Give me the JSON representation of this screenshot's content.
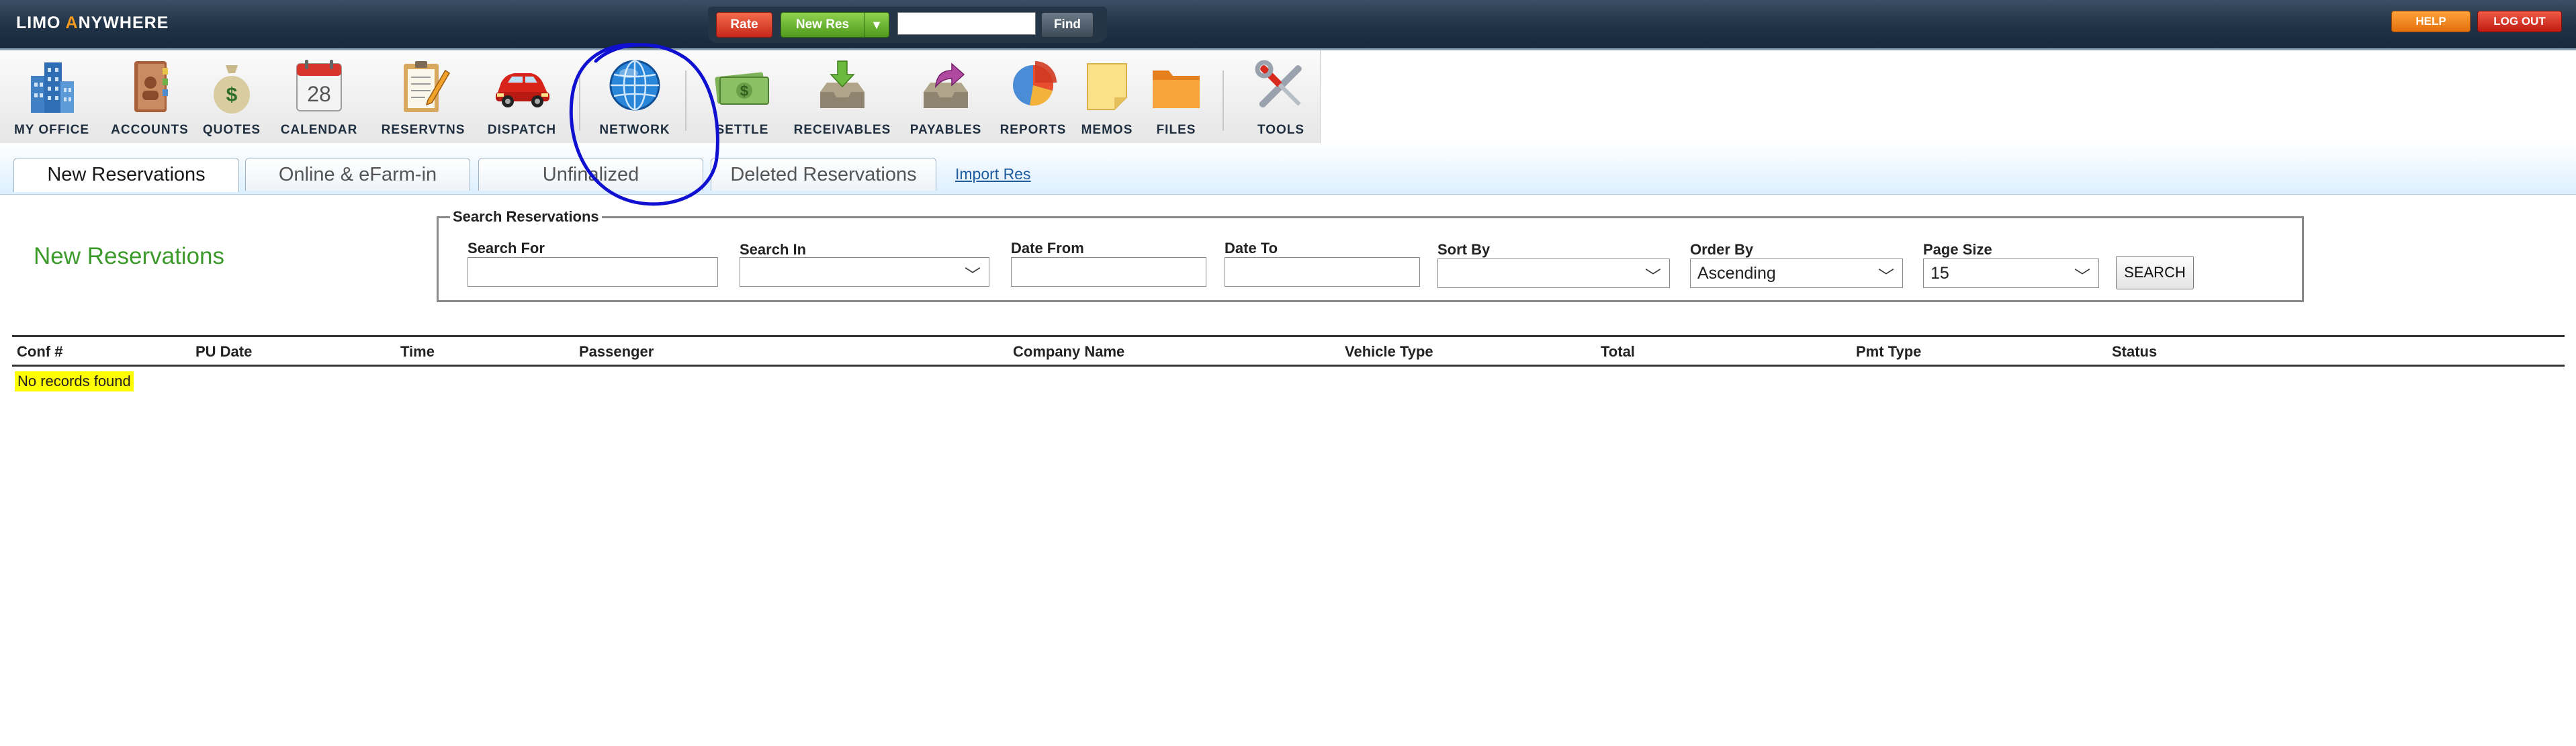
{
  "header": {
    "logo_text_1": "LIMO ",
    "logo_text_a": "A",
    "logo_text_2": "NYWHERE",
    "rate_label": "Rate",
    "new_res_label": "New Res",
    "find_placeholder": "",
    "find_label": "Find",
    "help_label": "HELP",
    "logout_label": "LOG OUT"
  },
  "toolbar": {
    "items": [
      {
        "label": "MY OFFICE",
        "icon": "office-building-icon"
      },
      {
        "label": "ACCOUNTS",
        "icon": "address-book-icon"
      },
      {
        "label": "QUOTES",
        "icon": "money-bag-icon"
      },
      {
        "label": "CALENDAR",
        "icon": "calendar-icon",
        "day": "28"
      },
      {
        "label": "RESERVTNS",
        "icon": "clipboard-pencil-icon"
      },
      {
        "label": "DISPATCH",
        "icon": "red-car-icon"
      },
      {
        "label": "NETWORK",
        "icon": "globe-icon"
      },
      {
        "label": "SETTLE",
        "icon": "cash-icon"
      },
      {
        "label": "RECEIVABLES",
        "icon": "inbox-arrow-icon"
      },
      {
        "label": "PAYABLES",
        "icon": "outbox-arrow-icon"
      },
      {
        "label": "REPORTS",
        "icon": "pie-chart-icon"
      },
      {
        "label": "MEMOS",
        "icon": "sticky-note-icon"
      },
      {
        "label": "FILES",
        "icon": "folder-icon"
      },
      {
        "label": "TOOLS",
        "icon": "wrench-screwdriver-icon"
      }
    ]
  },
  "tabs": [
    {
      "label": "New Reservations",
      "active": true
    },
    {
      "label": "Online & eFarm-in",
      "active": false
    },
    {
      "label": "Unfinalized",
      "active": false
    },
    {
      "label": "Deleted Reservations",
      "active": false
    }
  ],
  "import_link": "Import Res",
  "page_heading": "New Reservations",
  "search": {
    "legend": "Search Reservations",
    "search_for_label": "Search For",
    "search_for_value": "",
    "search_in_label": "Search In",
    "search_in_value": "",
    "date_from_label": "Date From",
    "date_from_value": "",
    "date_to_label": "Date To",
    "date_to_value": "",
    "sort_by_label": "Sort By",
    "sort_by_value": "",
    "order_by_label": "Order By",
    "order_by_value": "Ascending",
    "page_size_label": "Page Size",
    "page_size_value": "15",
    "search_button": "SEARCH"
  },
  "table": {
    "columns": [
      "Conf #",
      "PU Date",
      "Time",
      "Passenger",
      "Company Name",
      "Vehicle Type",
      "Total",
      "Pmt Type",
      "Status"
    ],
    "empty_message": "No records found"
  },
  "colors": {
    "header_bg": "#203246",
    "heading_green": "#3b9a2a",
    "annotation_blue": "#1010d0",
    "highlight_yellow": "#ffff00"
  }
}
